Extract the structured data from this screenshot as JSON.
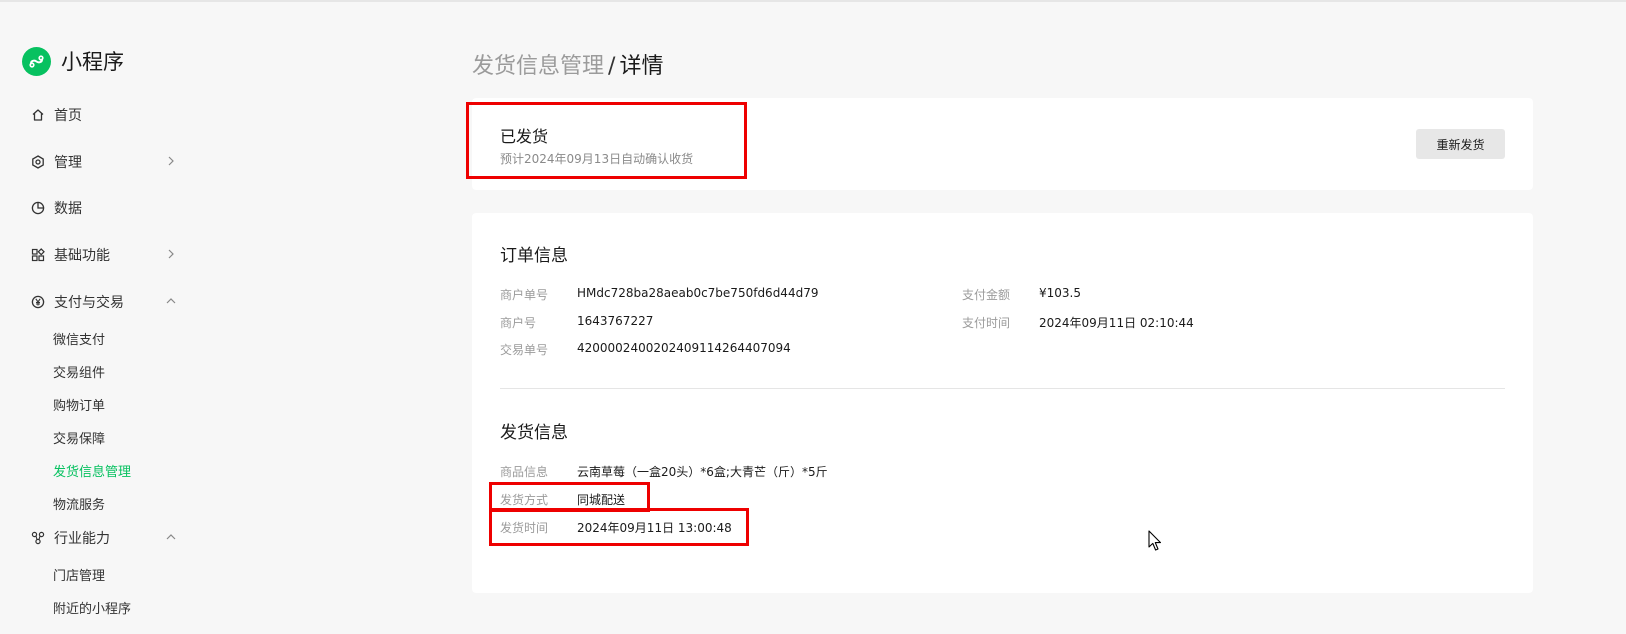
{
  "brand": {
    "name": "小程序",
    "logo_icon": "mini-program-logo-icon",
    "color": "#07c160"
  },
  "sidebar": {
    "items": [
      {
        "label": "首页",
        "icon": "home-icon"
      },
      {
        "label": "管理",
        "icon": "gear-icon",
        "expand": "collapsed"
      },
      {
        "label": "数据",
        "icon": "pie-chart-icon"
      },
      {
        "label": "基础功能",
        "icon": "grid-icon",
        "expand": "collapsed"
      },
      {
        "label": "支付与交易",
        "icon": "yuan-icon",
        "expand": "expanded",
        "children": [
          "微信支付",
          "交易组件",
          "购物订单",
          "交易保障",
          "发货信息管理",
          "物流服务"
        ]
      },
      {
        "label": "行业能力",
        "icon": "industry-icon",
        "expand": "expanded",
        "children": [
          "门店管理",
          "附近的小程序"
        ]
      }
    ],
    "active_item": "发货信息管理",
    "active_color": "#07c160"
  },
  "breadcrumb": {
    "parent": "发货信息管理",
    "separator": "/",
    "current": "详情"
  },
  "status_card": {
    "title": "已发货",
    "subtitle": "预计2024年09月13日自动确认收货",
    "button_label": "重新发货"
  },
  "order_info": {
    "title": "订单信息",
    "left": [
      {
        "key": "商户单号",
        "value": "HMdc728ba28aeab0c7be750fd6d44d79"
      },
      {
        "key": "商户号",
        "value": "1643767227"
      },
      {
        "key": "交易单号",
        "value": "4200002400202409114264407094"
      }
    ],
    "right": [
      {
        "key": "支付金额",
        "value": "¥103.5"
      },
      {
        "key": "支付时间",
        "value": "2024年09月11日 02:10:44"
      }
    ]
  },
  "shipping_info": {
    "title": "发货信息",
    "rows": [
      {
        "key": "商品信息",
        "value": "云南草莓（一盒20头）*6盒;大青芒（斤）*5斤"
      },
      {
        "key": "发货方式",
        "value": "同城配送"
      },
      {
        "key": "发货时间",
        "value": "2024年09月11日 13:00:48"
      }
    ]
  },
  "highlight_color": "#ee0000"
}
